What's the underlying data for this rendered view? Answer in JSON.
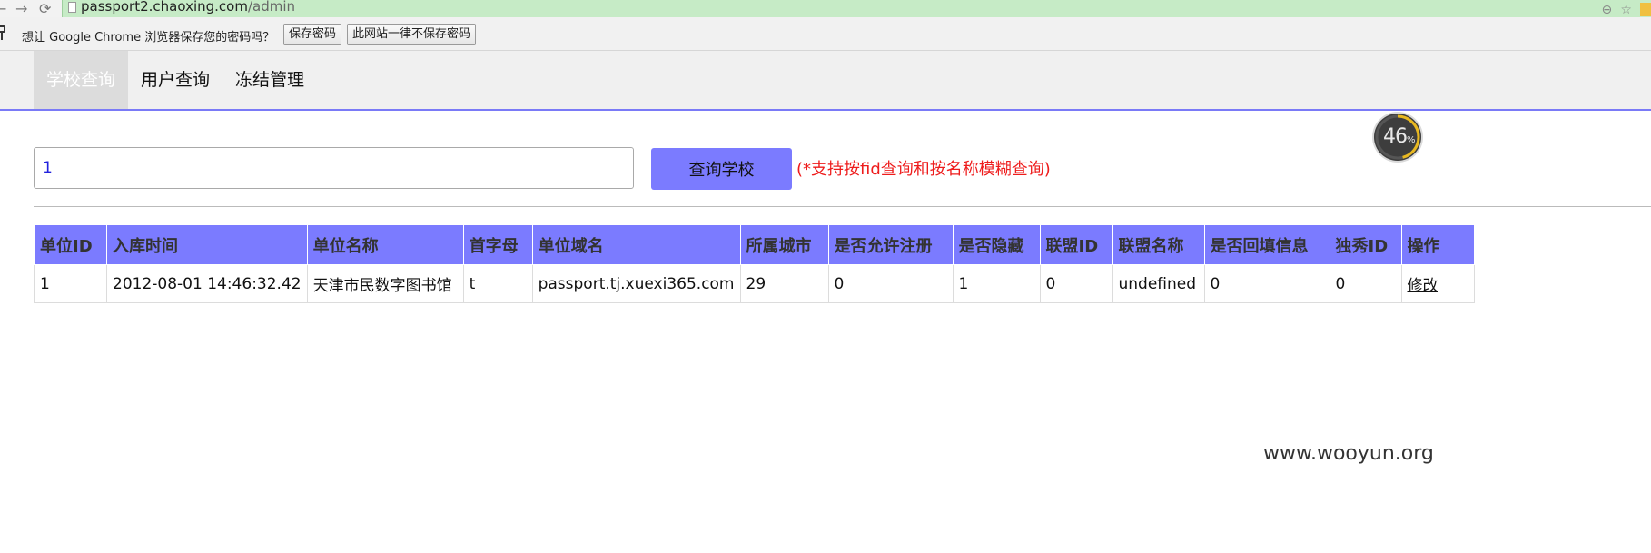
{
  "browser": {
    "url_host": "passport2.chaoxing.com",
    "url_path": "/admin",
    "back_icon": "back-arrow-icon",
    "forward_icon": "forward-arrow-icon",
    "reload_icon": "reload-icon"
  },
  "infobar": {
    "message": "想让 Google Chrome 浏览器保存您的密码吗？",
    "save_label": "保存密码",
    "never_label": "此网站一律不保存密码"
  },
  "nav": {
    "tabs": [
      {
        "label": "学校查询",
        "active": true
      },
      {
        "label": "用户查询",
        "active": false
      },
      {
        "label": "冻结管理",
        "active": false
      }
    ]
  },
  "progress": {
    "value": "46",
    "unit": "%",
    "fraction": 0.46
  },
  "search": {
    "value": "1",
    "button_label": "查询学校",
    "hint": "(*支持按fid查询和按名称模糊查询)"
  },
  "table": {
    "columns": [
      "单位ID",
      "入库时间",
      "单位名称",
      "首字母",
      "单位域名",
      "所属城市",
      "是否允许注册",
      "是否隐藏",
      "联盟ID",
      "联盟名称",
      "是否回填信息",
      "独秀ID",
      "操作"
    ],
    "rows": [
      [
        "1",
        "2012-08-01 14:46:32.42",
        "天津市民数字图书馆",
        "t",
        "passport.tj.xuexi365.com",
        "29",
        "0",
        "1",
        "0",
        "undefined",
        "0",
        "0",
        "修改"
      ]
    ]
  },
  "watermark": "www.wooyun.org",
  "colors": {
    "accent": "#7b7bff",
    "hint": "#ee1c1c",
    "omnibox": "#c6ebc6"
  }
}
